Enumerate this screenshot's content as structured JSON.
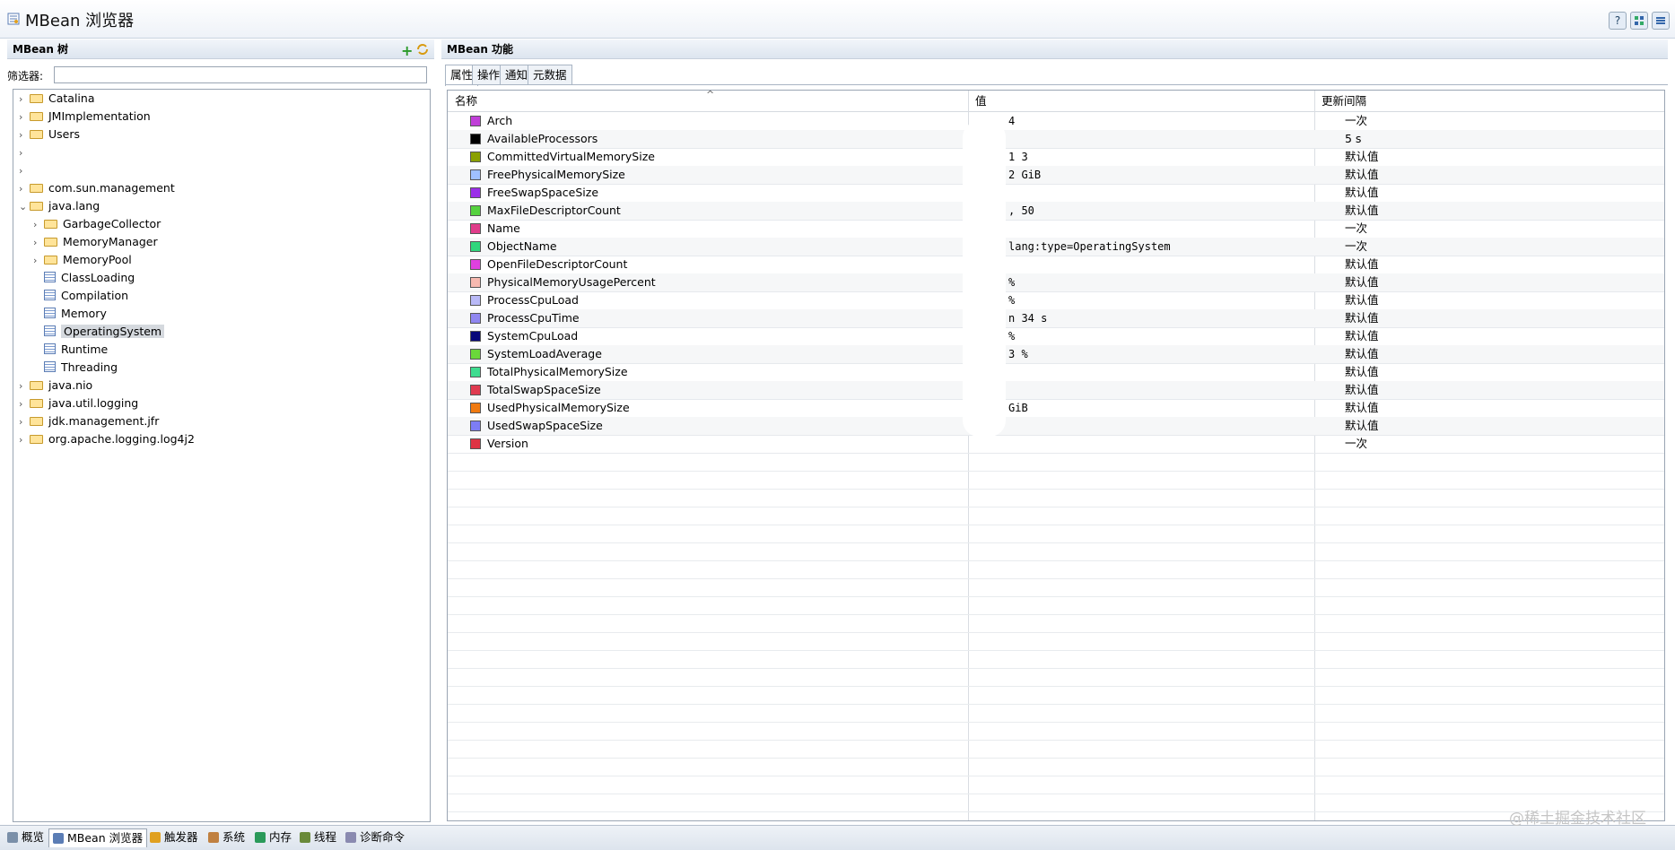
{
  "header": {
    "title": "MBean 浏览器",
    "help_icon": "?"
  },
  "left": {
    "panel_title": "MBean 树",
    "filter_label": "筛选器:",
    "filter_value": "",
    "tree": [
      {
        "label": "Catalina",
        "type": "folder",
        "depth": 0,
        "expander": "collapsed"
      },
      {
        "label": "JMImplementation",
        "type": "folder",
        "depth": 0,
        "expander": "collapsed"
      },
      {
        "label": "Users",
        "type": "folder",
        "depth": 0,
        "expander": "collapsed"
      },
      {
        "label": "",
        "type": "none",
        "depth": 0,
        "expander": "collapsed"
      },
      {
        "label": "",
        "type": "none",
        "depth": 0,
        "expander": "collapsed"
      },
      {
        "label": "com.sun.management",
        "type": "folder",
        "depth": 0,
        "expander": "collapsed"
      },
      {
        "label": "java.lang",
        "type": "folder",
        "depth": 0,
        "expander": "expanded"
      },
      {
        "label": "GarbageCollector",
        "type": "folder",
        "depth": 1,
        "expander": "collapsed"
      },
      {
        "label": "MemoryManager",
        "type": "folder",
        "depth": 1,
        "expander": "collapsed"
      },
      {
        "label": "MemoryPool",
        "type": "folder",
        "depth": 1,
        "expander": "collapsed"
      },
      {
        "label": "ClassLoading",
        "type": "mbean",
        "depth": 1,
        "expander": "none"
      },
      {
        "label": "Compilation",
        "type": "mbean",
        "depth": 1,
        "expander": "none"
      },
      {
        "label": "Memory",
        "type": "mbean",
        "depth": 1,
        "expander": "none"
      },
      {
        "label": "OperatingSystem",
        "type": "mbean",
        "depth": 1,
        "expander": "none",
        "selected": true
      },
      {
        "label": "Runtime",
        "type": "mbean",
        "depth": 1,
        "expander": "none"
      },
      {
        "label": "Threading",
        "type": "mbean",
        "depth": 1,
        "expander": "none"
      },
      {
        "label": "java.nio",
        "type": "folder",
        "depth": 0,
        "expander": "collapsed"
      },
      {
        "label": "java.util.logging",
        "type": "folder",
        "depth": 0,
        "expander": "collapsed"
      },
      {
        "label": "jdk.management.jfr",
        "type": "folder",
        "depth": 0,
        "expander": "collapsed"
      },
      {
        "label": "org.apache.logging.log4j2",
        "type": "folder",
        "depth": 0,
        "expander": "collapsed"
      }
    ]
  },
  "right": {
    "panel_title": "MBean 功能",
    "tabs": [
      "属性",
      "操作",
      "通知",
      "元数据"
    ],
    "columns": {
      "name": "名称",
      "value": "值",
      "interval": "更新间隔"
    },
    "rows": [
      {
        "name": "Arch",
        "color": "#c03fd8",
        "value": "  4",
        "interval": "一次"
      },
      {
        "name": "AvailableProcessors",
        "color": "#000000",
        "value": "",
        "interval": "5 s"
      },
      {
        "name": "CommittedVirtualMemorySize",
        "color": "#8aa000",
        "value": " 1  3",
        "interval": "默认值"
      },
      {
        "name": "FreePhysicalMemorySize",
        "color": "#9fc0ff",
        "value": " 2 GiB",
        "interval": "默认值"
      },
      {
        "name": "FreeSwapSpaceSize",
        "color": "#9b2ee8",
        "value": "",
        "interval": "默认值"
      },
      {
        "name": "MaxFileDescriptorCount",
        "color": "#56d23f",
        "value": " , 50",
        "interval": "默认值"
      },
      {
        "name": "Name",
        "color": "#e03c8a",
        "value": "",
        "interval": "一次"
      },
      {
        "name": "ObjectName",
        "color": "#2fd67c",
        "value": "  lang:type=OperatingSystem",
        "interval": "一次"
      },
      {
        "name": "OpenFileDescriptorCount",
        "color": "#e040e0",
        "value": "",
        "interval": "默认值"
      },
      {
        "name": "PhysicalMemoryUsagePercent",
        "color": "#f7b9b0",
        "value": "   %",
        "interval": "默认值"
      },
      {
        "name": "ProcessCpuLoad",
        "color": "#b9b9f7",
        "value": "   %",
        "interval": "默认值"
      },
      {
        "name": "ProcessCpuTime",
        "color": "#8f86f0",
        "value": " n 34 s",
        "interval": "默认值"
      },
      {
        "name": "SystemCpuLoad",
        "color": "#08087a",
        "value": "   %",
        "interval": "默认值"
      },
      {
        "name": "SystemLoadAverage",
        "color": "#6ad83a",
        "value": "  3 %",
        "interval": "默认值"
      },
      {
        "name": "TotalPhysicalMemorySize",
        "color": "#3fdc8f",
        "value": "",
        "interval": "默认值"
      },
      {
        "name": "TotalSwapSpaceSize",
        "color": "#e03b50",
        "value": "",
        "interval": "默认值"
      },
      {
        "name": "UsedPhysicalMemorySize",
        "color": "#f07a10",
        "value": "  GiB",
        "interval": "默认值"
      },
      {
        "name": "UsedSwapSpaceSize",
        "color": "#7d7df5",
        "value": "",
        "interval": "默认值"
      },
      {
        "name": "Version",
        "color": "#dd3344",
        "value": "",
        "interval": "一次"
      }
    ]
  },
  "bottom_tabs": [
    {
      "label": "概览",
      "icon": "overview-icon",
      "active": false
    },
    {
      "label": "MBean 浏览器",
      "icon": "mbean-icon",
      "active": true
    },
    {
      "label": "触发器",
      "icon": "trigger-icon",
      "active": false
    },
    {
      "label": "系统",
      "icon": "system-icon",
      "active": false
    },
    {
      "label": "内存",
      "icon": "memory-icon",
      "active": false
    },
    {
      "label": "线程",
      "icon": "thread-icon",
      "active": false
    },
    {
      "label": "诊断命令",
      "icon": "diagnostic-icon",
      "active": false
    }
  ],
  "watermark": "@稀土掘金技术社区"
}
